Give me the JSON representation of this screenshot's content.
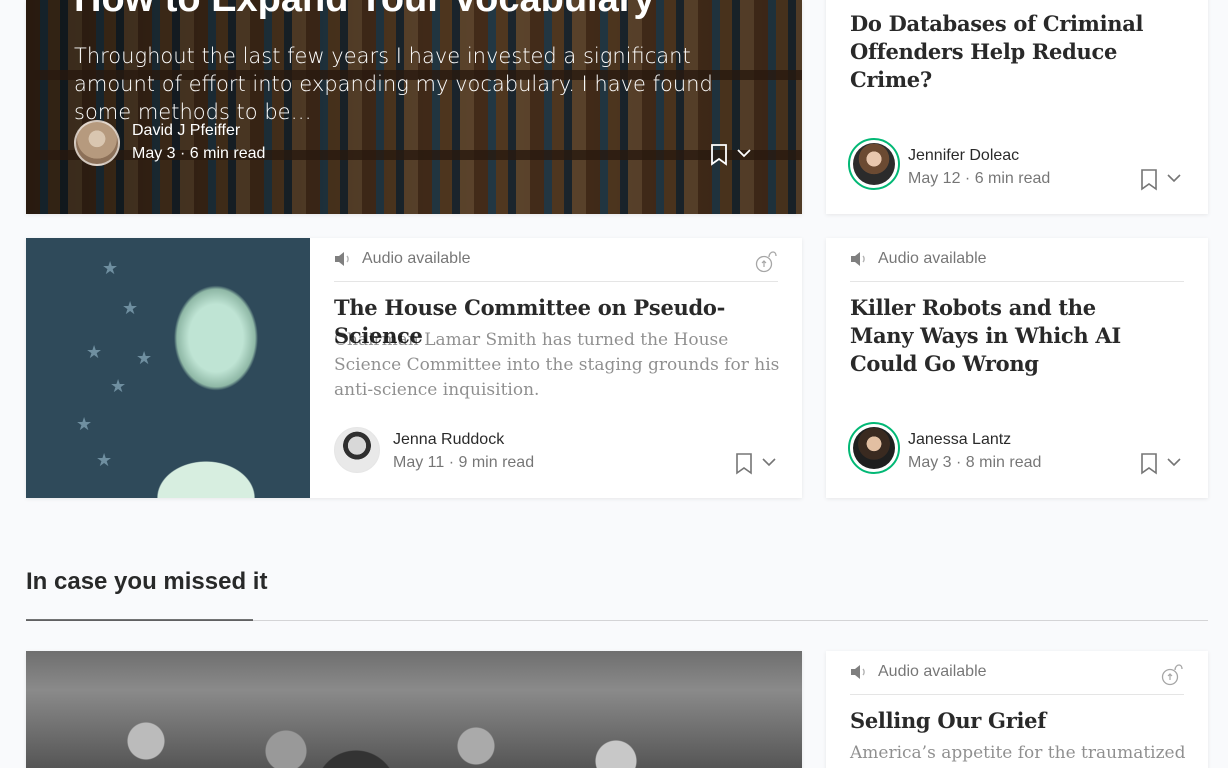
{
  "hero": {
    "title": "How to Expand Your Vocabulary",
    "excerpt": "Throughout the last few years I have invested a significant amount of effort into expanding my vocabulary. I have found some methods to be…",
    "author": "David J Pfeiffer",
    "meta": "May 3 · 6 min read"
  },
  "card_crime": {
    "title": "Do Databases of Criminal Offenders Help Reduce Crime?",
    "author": "Jennifer Doleac",
    "meta": "May 12 · 6 min read"
  },
  "card_house": {
    "audio": "Audio available",
    "title": "The House Committee on Pseudo-Science",
    "excerpt": "Chairman Lamar Smith has turned the House Science Committee into the staging grounds for his anti-science inquisition.",
    "author": "Jenna Ruddock",
    "meta": "May 11 · 9 min read"
  },
  "card_robots": {
    "audio": "Audio available",
    "title": "Killer Robots and the Many Ways in Which AI Could Go Wrong",
    "author": "Janessa Lantz",
    "meta": "May 3 · 8 min read"
  },
  "section": {
    "title": "In case you missed it"
  },
  "card_grief": {
    "audio": "Audio available",
    "title": "Selling Our Grief",
    "excerpt": "America’s appetite for the traumatized"
  },
  "colors": {
    "accent_green": "#02b875",
    "text_muted": "rgba(0,0,0,.54)"
  },
  "icons": [
    "bookmark-icon",
    "chevron-down-icon",
    "speaker-icon",
    "member-lock-icon"
  ]
}
